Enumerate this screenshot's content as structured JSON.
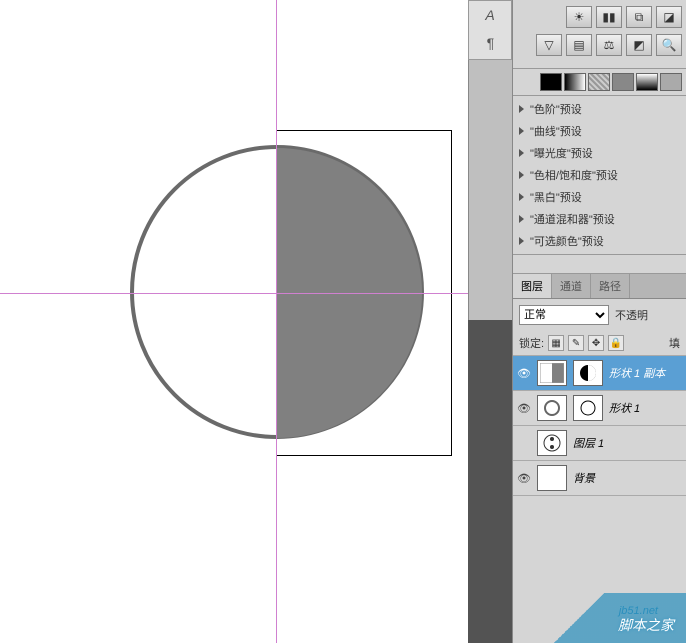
{
  "typebar": {
    "a": "A",
    "para": "¶"
  },
  "presets": [
    "\"色阶\"预设",
    "\"曲线\"预设",
    "\"曝光度\"预设",
    "\"色相/饱和度\"预设",
    "\"黑白\"预设",
    "\"通道混和器\"预设",
    "\"可选颜色\"预设"
  ],
  "tabs": {
    "layers": "图层",
    "channels": "通道",
    "paths": "路径"
  },
  "blend": {
    "mode": "正常",
    "opacity_label": "不透明"
  },
  "lock": {
    "label": "锁定:",
    "fill_label": "填"
  },
  "layers": [
    {
      "name": "形状 1 副本",
      "selected": true,
      "hasmask": true,
      "thumb": "half"
    },
    {
      "name": "形状 1",
      "selected": false,
      "hasmask": true,
      "thumb": "ring"
    },
    {
      "name": "图层 1",
      "selected": false,
      "hasmask": false,
      "thumb": "yy"
    },
    {
      "name": "背景",
      "selected": false,
      "hasmask": false,
      "thumb": "white"
    }
  ],
  "watermark": {
    "url": "jb51.net",
    "name": "脚本之家"
  }
}
